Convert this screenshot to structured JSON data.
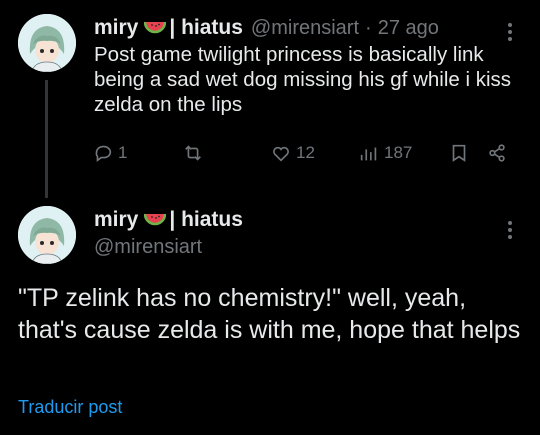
{
  "tweet1": {
    "author_name": "miry",
    "name_suffix": "| hiatus",
    "handle": "@mirensiart",
    "separator": "·",
    "time": "27 ago",
    "text": "Post game twilight princess is basically link being a sad wet dog missing his gf while i kiss zelda on the lips",
    "actions": {
      "reply_count": "1",
      "retweet_count": "",
      "like_count": "12",
      "views_count": "187"
    }
  },
  "tweet2": {
    "author_name": "miry",
    "name_suffix": "| hiatus",
    "handle": "@mirensiart",
    "text": "\"TP zelink has no chemistry!\" well, yeah, that's cause zelda is with me, hope that helps",
    "translate_label": "Traducir post"
  },
  "colors": {
    "background": "#000000",
    "text": "#e7e9ea",
    "muted": "#71767b",
    "link": "#1d9bf0"
  },
  "icons": [
    "watermelon-icon",
    "more-options-icon",
    "reply-icon",
    "retweet-icon",
    "like-icon",
    "views-icon",
    "bookmark-icon",
    "share-icon"
  ]
}
